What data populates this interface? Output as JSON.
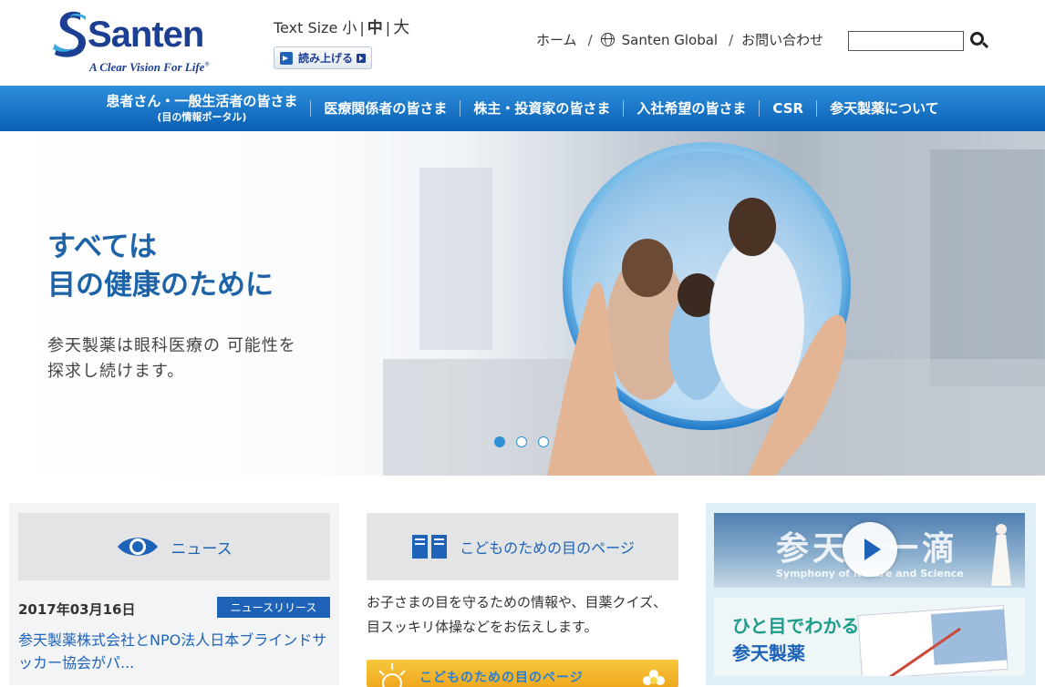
{
  "header": {
    "logo_text": "Santen",
    "tagline": "A Clear Vision For Life",
    "text_size": {
      "label": "Text Size",
      "small": "小",
      "medium": "中",
      "large": "大",
      "separator": "|"
    },
    "read_aloud": "読み上げる",
    "util_nav": [
      {
        "label": "ホーム",
        "sep": "/"
      },
      {
        "label": "Santen Global",
        "sep": "/"
      },
      {
        "label": "お問い合わせ"
      }
    ],
    "search": {
      "value": "",
      "placeholder": ""
    }
  },
  "main_nav": [
    {
      "label": "患者さん・一般生活者の皆さま",
      "sub": "(目の情報ポータル)"
    },
    {
      "label": "医療関係者の皆さま"
    },
    {
      "label": "株主・投資家の皆さま"
    },
    {
      "label": "入社希望の皆さま"
    },
    {
      "label": "CSR"
    },
    {
      "label": "参天製薬について"
    }
  ],
  "hero": {
    "headline_line1": "すべては",
    "headline_line2": "目の健康のために",
    "subcopy_line1": "参天製薬は眼科医療の 可能性を",
    "subcopy_line2": "探求し続けます。",
    "slides": 3,
    "active_slide": 1
  },
  "news": {
    "title": "ニュース",
    "date": "2017年03月16日",
    "badge": "ニュースリリース",
    "link": "参天製薬株式会社とNPO法人日本ブラインドサッカー協会がパ..."
  },
  "kids": {
    "title": "こどものための目のページ",
    "description": "お子さまの目を守るための情報や、目薬クイズ、目スッキリ体操などをお伝えします。",
    "banner": "こどものための目のページ"
  },
  "video": {
    "title": "参天　一滴",
    "subtitle": "Symphony of Nature and Science"
  },
  "about": {
    "line1": "ひと目でわかる",
    "line2": "参天製薬"
  },
  "colors": {
    "brand_blue": "#1e63b8",
    "nav_top": "#2d8fdc",
    "nav_bottom": "#0a5fb3",
    "teal": "#1f9c8c"
  }
}
